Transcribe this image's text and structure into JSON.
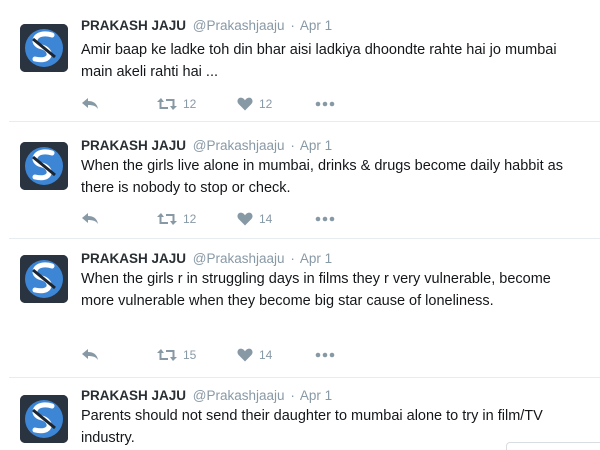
{
  "tweets": [
    {
      "name": "PRAKASH JAJU",
      "handle": "@Prakashjaaju",
      "separator": "·",
      "date": "Apr 1",
      "text": "Amir baap ke ladke toh din bhar aisi ladkiya dhoondte rahte hai jo mumbai main akeli rahti hai ...",
      "retweets": "12",
      "likes": "12"
    },
    {
      "name": "PRAKASH JAJU",
      "handle": "@Prakashjaaju",
      "separator": "·",
      "date": "Apr 1",
      "text": "When the girls live alone in mumbai, drinks & drugs become daily habbit as there is nobody to stop or check.",
      "retweets": "12",
      "likes": "14"
    },
    {
      "name": "PRAKASH JAJU",
      "handle": "@Prakashjaaju",
      "separator": "·",
      "date": "Apr 1",
      "text": "When the girls r in struggling days in films they r very vulnerable, become more vulnerable when they become big star cause of loneliness.",
      "retweets": "15",
      "likes": "14"
    },
    {
      "name": "PRAKASH JAJU",
      "handle": "@Prakashjaaju",
      "separator": "·",
      "date": "Apr 1",
      "text": "Parents should not send their daughter to mumbai alone to try in film/TV industry."
    }
  ],
  "icons": {
    "reply": "reply-icon",
    "retweet": "retweet-icon",
    "like": "heart-icon",
    "more": "more-dots-icon",
    "avatar": "profile-avatar"
  },
  "colors": {
    "name": "#292f33",
    "meta": "#8899a6",
    "text": "#14171a",
    "divider": "#e6ecf0",
    "avatar_blue": "#3d86d6"
  }
}
